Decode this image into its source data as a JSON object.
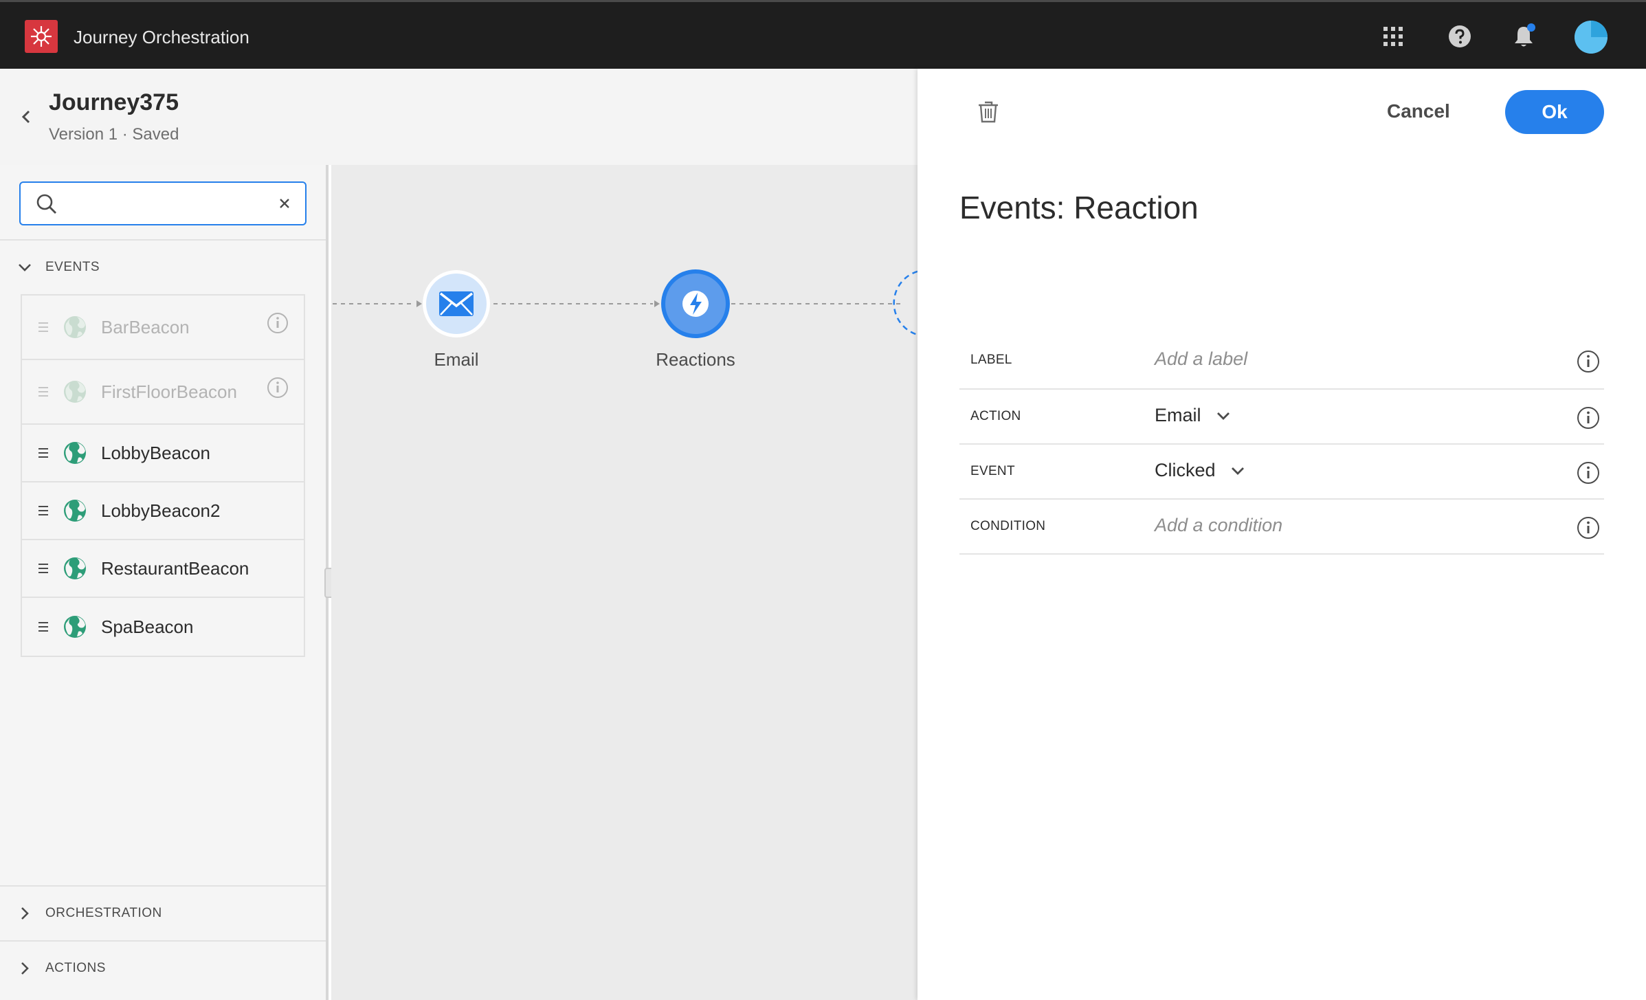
{
  "app": {
    "title": "Journey Orchestration",
    "accent_color": "#2680eb",
    "brand_color": "#d7373f"
  },
  "journey": {
    "name": "Journey375",
    "version": "Version 1 · Saved"
  },
  "search": {
    "value": "",
    "placeholder": ""
  },
  "sidebar": {
    "events_label": "EVENTS",
    "orchestration_label": "ORCHESTRATION",
    "actions_label": "ACTIONS",
    "events": [
      {
        "label": "BarBeacon",
        "disabled": true
      },
      {
        "label": "FirstFloorBeacon",
        "disabled": true
      },
      {
        "label": "LobbyBeacon",
        "disabled": false
      },
      {
        "label": "LobbyBeacon2",
        "disabled": false
      },
      {
        "label": "RestaurantBeacon",
        "disabled": false
      },
      {
        "label": "SpaBeacon",
        "disabled": false
      }
    ]
  },
  "canvas": {
    "nodes": [
      {
        "label": "Email",
        "icon": "mail-icon"
      },
      {
        "label": "Reactions",
        "icon": "lightning-icon"
      }
    ]
  },
  "panel": {
    "title": "Events: Reaction",
    "cancel_label": "Cancel",
    "ok_label": "Ok",
    "rows": [
      {
        "key": "LABEL",
        "value": "Add a label",
        "placeholder": true,
        "dropdown": false
      },
      {
        "key": "ACTION",
        "value": "Email",
        "placeholder": false,
        "dropdown": true
      },
      {
        "key": "EVENT",
        "value": "Clicked",
        "placeholder": false,
        "dropdown": true
      },
      {
        "key": "CONDITION",
        "value": "Add a condition",
        "placeholder": true,
        "dropdown": false
      }
    ]
  }
}
